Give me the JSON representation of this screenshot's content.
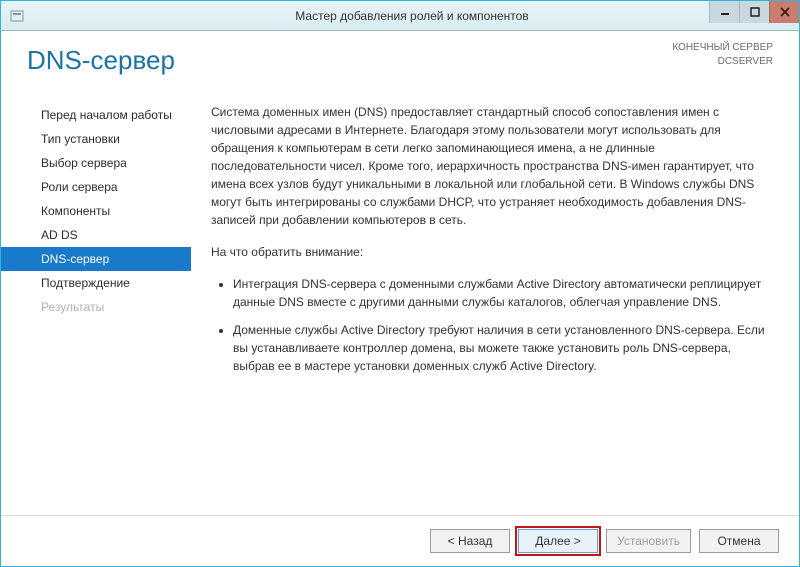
{
  "window": {
    "title": "Мастер добавления ролей и компонентов"
  },
  "header": {
    "page_title": "DNS-сервер",
    "destination_label": "КОНЕЧНЫЙ СЕРВЕР",
    "destination_server": "DCSERVER"
  },
  "steps": [
    {
      "label": "Перед началом работы",
      "state": "normal"
    },
    {
      "label": "Тип установки",
      "state": "normal"
    },
    {
      "label": "Выбор сервера",
      "state": "normal"
    },
    {
      "label": "Роли сервера",
      "state": "normal"
    },
    {
      "label": "Компоненты",
      "state": "normal"
    },
    {
      "label": "AD DS",
      "state": "normal"
    },
    {
      "label": "DNS-сервер",
      "state": "active"
    },
    {
      "label": "Подтверждение",
      "state": "normal"
    },
    {
      "label": "Результаты",
      "state": "disabled"
    }
  ],
  "content": {
    "intro": "Система доменных имен (DNS) предоставляет стандартный способ сопоставления имен с числовыми адресами в Интернете. Благодаря этому пользователи могут использовать для обращения к компьютерам в сети легко запоминающиеся имена, а не длинные последовательности чисел. Кроме того, иерархичность пространства DNS-имен гарантирует, что имена всех узлов будут уникальными в локальной или глобальной сети. В Windows службы DNS могут быть интегрированы со службами DHCP, что устраняет необходимость добавления DNS-записей при добавлении компьютеров в сеть.",
    "note_heading": "На что обратить внимание:",
    "bullets": [
      "Интеграция DNS-сервера с доменными службами Active Directory автоматически реплицирует данные DNS вместе с другими данными службы каталогов, облегчая управление DNS.",
      "Доменные службы Active Directory требуют наличия в сети установленного DNS-сервера. Если вы устанавливаете контроллер домена, вы можете также установить роль DNS-сервера, выбрав ее в мастере установки доменных служб Active Directory."
    ]
  },
  "footer": {
    "back": "< Назад",
    "next": "Далее >",
    "install": "Установить",
    "cancel": "Отмена"
  }
}
